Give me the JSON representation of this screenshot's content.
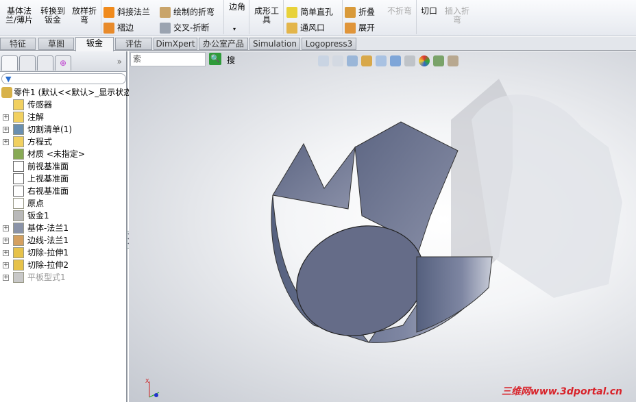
{
  "ribbon": {
    "base_flange": "基体法\n兰/薄片",
    "convert": "转换到\n钣金",
    "lofted_bend": "放样折\n弯",
    "miter_flange": "斜接法兰",
    "hem": "褶边",
    "sketched_bend": "绘制的折弯",
    "cross_break": "交叉-折断",
    "corners": "边角",
    "forming_tool": "成形工\n具",
    "simple_hole": "简单直孔",
    "vent": "通风口",
    "fold": "折叠",
    "unfold": "展开",
    "no_bends": "不折弯",
    "rip": "切口",
    "insert_bends": "插入折\n弯"
  },
  "tabs": [
    "特征",
    "草图",
    "钣金",
    "评估",
    "DimXpert",
    "办公室产品",
    "Simulation",
    "Logopress3"
  ],
  "active_tab": "钣金",
  "search": {
    "value": "索",
    "button_label": "搜"
  },
  "tree": {
    "root": "零件1  (默认<<默认>_显示状态",
    "items": [
      {
        "label": "传感器",
        "expand": false,
        "icon": "sensor-icon"
      },
      {
        "label": "注解",
        "expand": true,
        "icon": "annotation-icon"
      },
      {
        "label": "切割清单(1)",
        "expand": true,
        "icon": "cut-list-icon"
      },
      {
        "label": "方程式",
        "expand": true,
        "icon": "equation-icon"
      },
      {
        "label": "材质 <未指定>",
        "expand": false,
        "icon": "material-icon"
      },
      {
        "label": "前视基准面",
        "expand": false,
        "icon": "plane-icon"
      },
      {
        "label": "上视基准面",
        "expand": false,
        "icon": "plane-icon"
      },
      {
        "label": "右视基准面",
        "expand": false,
        "icon": "plane-icon"
      },
      {
        "label": "原点",
        "expand": false,
        "icon": "origin-icon"
      },
      {
        "label": "钣金1",
        "expand": false,
        "icon": "sheetmetal-icon"
      },
      {
        "label": "基体-法兰1",
        "expand": true,
        "icon": "base-flange-icon"
      },
      {
        "label": "边线-法兰1",
        "expand": true,
        "icon": "edge-flange-icon"
      },
      {
        "label": "切除-拉伸1",
        "expand": true,
        "icon": "cut-extrude-icon"
      },
      {
        "label": "切除-拉伸2",
        "expand": true,
        "icon": "cut-extrude-icon"
      },
      {
        "label": "平板型式1",
        "expand": true,
        "icon": "flat-pattern-icon",
        "suppressed": true
      }
    ]
  },
  "watermark": "三维网www.3dportal.cn",
  "colors": {
    "part": "#6b7290",
    "accent": "#2f9b3a",
    "watermark": "#d8232a"
  }
}
